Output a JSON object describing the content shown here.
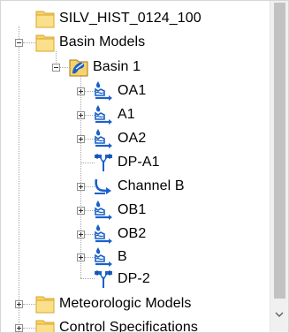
{
  "tree": {
    "root": {
      "label": "SILV_HIST_0124_100",
      "icon": "folder-icon"
    },
    "basin_models": {
      "label": "Basin Models",
      "icon": "folder-icon",
      "expanded": true
    },
    "basin_1": {
      "label": "Basin 1",
      "icon": "basin-icon",
      "expanded": true
    },
    "elements": [
      {
        "label": "OA1",
        "icon": "subbasin-icon",
        "expandable": true
      },
      {
        "label": "A1",
        "icon": "subbasin-icon",
        "expandable": true
      },
      {
        "label": "OA2",
        "icon": "subbasin-icon",
        "expandable": true
      },
      {
        "label": "DP-A1",
        "icon": "junction-icon",
        "expandable": false
      },
      {
        "label": "Channel B",
        "icon": "reach-icon",
        "expandable": true
      },
      {
        "label": "OB1",
        "icon": "subbasin-icon",
        "expandable": true
      },
      {
        "label": "OB2",
        "icon": "subbasin-icon",
        "expandable": true
      },
      {
        "label": "B",
        "icon": "subbasin-icon",
        "expandable": true
      },
      {
        "label": "DP-2",
        "icon": "junction-icon",
        "expandable": false
      }
    ],
    "meteorologic_models": {
      "label": "Meteorologic Models",
      "icon": "folder-icon",
      "expandable": true
    },
    "control_specifications": {
      "label": "Control Specifications",
      "icon": "folder-icon",
      "expandable": true
    }
  },
  "colors": {
    "folder": "#f7d36b",
    "folder_edge": "#d9a628",
    "hydro_blue": "#1a61c9",
    "scrollbar_thumb": "#c2c2c2"
  }
}
